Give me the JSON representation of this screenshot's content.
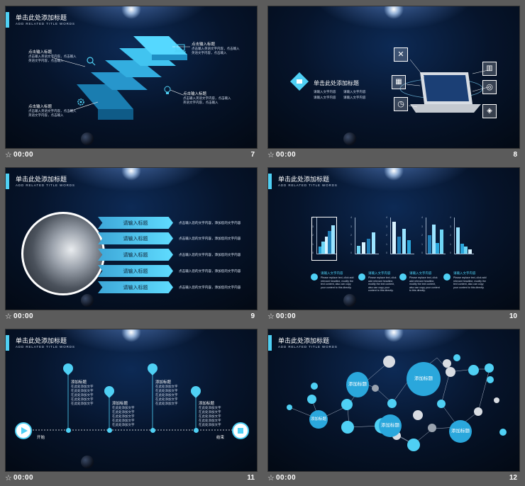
{
  "colors": {
    "accent": "#4fd0f4",
    "bg_gray": "#5b5b5b",
    "deep_blue": "#02070f"
  },
  "slides": [
    {
      "number": "7",
      "time": "00:00",
      "star": "☆",
      "title": "单击此处添加标题",
      "subtitle": "ADD RELATED TITLE WORDS",
      "callouts": [
        {
          "title": "点击输入标题",
          "text": "点击输入英语文字内容，点击输入英语文字内容，点击输入"
        },
        {
          "title": "点击输入标题",
          "text": "点击输入英语文字内容，点击输入英语文字内容，点击输入"
        },
        {
          "title": "点击输入标题",
          "text": "点击输入英语文字内容，点击输入英语文字内容，点击输入"
        },
        {
          "title": "点击输入标题",
          "text": "点击输入英语文字内容，点击输入英语文字内容，点击输入"
        }
      ]
    },
    {
      "number": "8",
      "time": "00:00",
      "star": "☆",
      "title": "单击此处添加标题",
      "texts": [
        "请输入文字内容",
        "请输入文字内容",
        "请输入文字内容",
        "请输入文字内容"
      ]
    },
    {
      "number": "9",
      "time": "00:00",
      "star": "☆",
      "title": "单击此处添加标题",
      "subtitle": "ADD RELATED TITLE WORDS",
      "banners": [
        "请输入标题",
        "请输入标题",
        "请输入标题",
        "请输入标题",
        "请输入标题"
      ],
      "desc": "点击输入您的文字内容，添加您的文字内容"
    },
    {
      "number": "10",
      "time": "00:00",
      "star": "☆",
      "title": "单击此处添加标题",
      "subtitle": "ADD RELATED TITLE WORDS",
      "captions": [
        "请输入文字内容",
        "请输入文字内容",
        "请输入文字内容",
        "请输入文字内容"
      ],
      "caption_text": "Please replace text, click add relevant headline, modify the text content, also can copy your content to this directly."
    },
    {
      "number": "11",
      "time": "00:00",
      "star": "☆",
      "title": "单击此处添加标题",
      "subtitle": "ADD RELATED TITLE WORDS",
      "steps": [
        "添加标题",
        "添加标题",
        "添加标题",
        "添加标题"
      ],
      "step_text": "在此处添加文字在此处添加文字在此处添加文字在此处添加文字在此处添加文字",
      "start_label": "开始",
      "end_label": "结束"
    },
    {
      "number": "12",
      "time": "00:00",
      "star": "☆",
      "title": "单击此处添加标题",
      "subtitle": "ADD RELATED TITLE WORDS",
      "bubbles": [
        "添加标题",
        "添加标题",
        "添加标题",
        "添加标题",
        "添加标题"
      ]
    }
  ],
  "chart_data": {
    "type": "bar",
    "charts": [
      {
        "yticks": [
          "4",
          "3",
          "2",
          "1",
          "0"
        ],
        "series": [
          {
            "name": "",
            "values": [
              0.8,
              1.4,
              1.9,
              2.6,
              3.2
            ]
          }
        ]
      },
      {
        "yticks": [
          "4",
          "3",
          "2",
          "1",
          "0"
        ],
        "series": [
          {
            "name": "",
            "values": [
              0.9,
              1.3,
              1.7,
              2.4
            ]
          }
        ]
      },
      {
        "yticks": [
          "4",
          "3",
          "2",
          "1",
          "0"
        ],
        "series": [
          {
            "name": "",
            "values": [
              3.6,
              1.9,
              2.8,
              1.5
            ]
          }
        ]
      },
      {
        "yticks": [
          "4",
          "3",
          "2",
          "1",
          "0"
        ],
        "series": [
          {
            "name": "",
            "values": [
              2.1,
              3.3,
              1.2,
              2.7
            ]
          }
        ]
      },
      {
        "yticks": [
          "4",
          "3",
          "2",
          "1",
          "0"
        ],
        "series": [
          {
            "name": "",
            "values": [
              3.0,
              1.1,
              0.8,
              0.5
            ]
          }
        ]
      }
    ]
  }
}
